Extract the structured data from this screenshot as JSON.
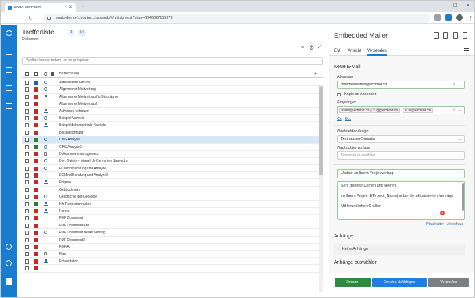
{
  "browser": {
    "tab_title": "enaio webclient",
    "url": "enaio-demo-1.ecmind.ch/osweb/#/hitlist/result?state=1746627105373"
  },
  "results": {
    "title": "Trefferliste",
    "count_a": "1",
    "count_b": "54",
    "subtitle": "Dokument",
    "group_placeholder": "Spalten hierher ziehen, um zu gruppieren",
    "col_name": "Bezeichnung",
    "col_add": "+",
    "rows": [
      {
        "name": "Aktualisierte Version",
        "t": "word",
        "s": "circle"
      },
      {
        "name": "Allgemeiner Mietvertrag",
        "t": "pdf",
        "s": "circle"
      },
      {
        "name": "Allgemeiner Mietvertrag für Büroräume",
        "t": "pdf",
        "s": "net"
      },
      {
        "name": "Allgemeiner Mietvertrag2",
        "t": "pdf",
        "s": "none"
      },
      {
        "name": "Aufwände schätzen",
        "t": "pdf",
        "s": "netred"
      },
      {
        "name": "Beispiel Verweis",
        "t": "pdf",
        "s": "circle"
      },
      {
        "name": "Beispieldokument inkl Kapiteln",
        "t": "pdf",
        "s": "net"
      },
      {
        "name": "Beispielformular",
        "t": "pdf",
        "s": "none"
      },
      {
        "name": "CMS Analyse",
        "t": "excel",
        "s": "circle",
        "sel": true
      },
      {
        "name": "CMS Analyse2",
        "t": "excel",
        "s": "circle"
      },
      {
        "name": "Dokumentenmanagement",
        "t": "pdf",
        "s": "lock"
      },
      {
        "name": "Don Quijote - Miguel de Cervantes Saavedra",
        "t": "pdf",
        "s": "circle"
      },
      {
        "name": "ECMind Beratung und Analyse",
        "t": "pdf",
        "s": "circle"
      },
      {
        "name": "ECMind Beratung und Analyse2",
        "t": "pdf",
        "s": "none"
      },
      {
        "name": "Enigma",
        "t": "pdf",
        "s": "net"
      },
      {
        "name": "Gebäudeplan",
        "t": "pdf",
        "s": "none"
      },
      {
        "name": "Geschichte der Geologie",
        "t": "pdf",
        "s": "circle"
      },
      {
        "name": "Kfz Reparaturtracker",
        "t": "excel",
        "s": "net"
      },
      {
        "name": "Parser",
        "t": "pdf",
        "s": "net"
      },
      {
        "name": "PDF Dokument",
        "t": "pdf",
        "s": "none"
      },
      {
        "name": "PDF Dokument ABC",
        "t": "pdf",
        "s": "none"
      },
      {
        "name": "PDF Dokument Neuer Vertrag",
        "t": "pdf",
        "s": "circle"
      },
      {
        "name": "PDF Dokument2",
        "t": "pdf",
        "s": "none"
      },
      {
        "name": "PDF/A",
        "t": "pdf",
        "s": "none"
      },
      {
        "name": "Plan",
        "t": "pdf",
        "s": "lock"
      },
      {
        "name": "Präsentation",
        "t": "pdf",
        "s": "net"
      },
      {
        "name": "",
        "t": "pdf",
        "s": "none"
      }
    ]
  },
  "mailer": {
    "title": "Embedded Mailer",
    "tabs": [
      "EM",
      "Ansicht",
      "Versenden"
    ],
    "new_mail": "Neue E-Mail",
    "sender_label": "Absender",
    "sender_value": "maildashlettest@ecmind.ch",
    "copy_label": "Kopie an Absender",
    "recipients_label": "Empfänger",
    "recipients": [
      "info@ecmind.ch",
      "lg@ecmind.ch",
      "ue@ecmind.ch"
    ],
    "cc": "Cc",
    "bcc": "Bcc",
    "design_label": "Nachrichtendesign",
    "design_value": "Testhausen-Signatur",
    "template_label": "Nachrichtenvorlage",
    "template_placeholder": "Template auswählen",
    "subject": "Update zu Ihrem Projektvertrag",
    "body": [
      "Sehr geehrte Damen und Herren,",
      "",
      "zu Ihrem Projekt ${Project_Name} anbei die aktualisierten Verträge.",
      "",
      "Mit freundlichen Grüßen"
    ],
    "badge": "1",
    "placeholder_link": "Platzhalter",
    "preview_link": "Vorschau",
    "attachments_title": "Anhänge",
    "no_attachments": "Keine Anhänge",
    "select_attachments": "Anhänge auswählen",
    "btn_send": "Senden",
    "btn_send_file": "Senden & Ablegen",
    "btn_discard": "Verwerfen",
    "colors": {
      "send": "#2e8b3d",
      "send_file": "#1e7fe0",
      "discard": "#7b7f85",
      "accent": "#1a7ccf"
    }
  }
}
